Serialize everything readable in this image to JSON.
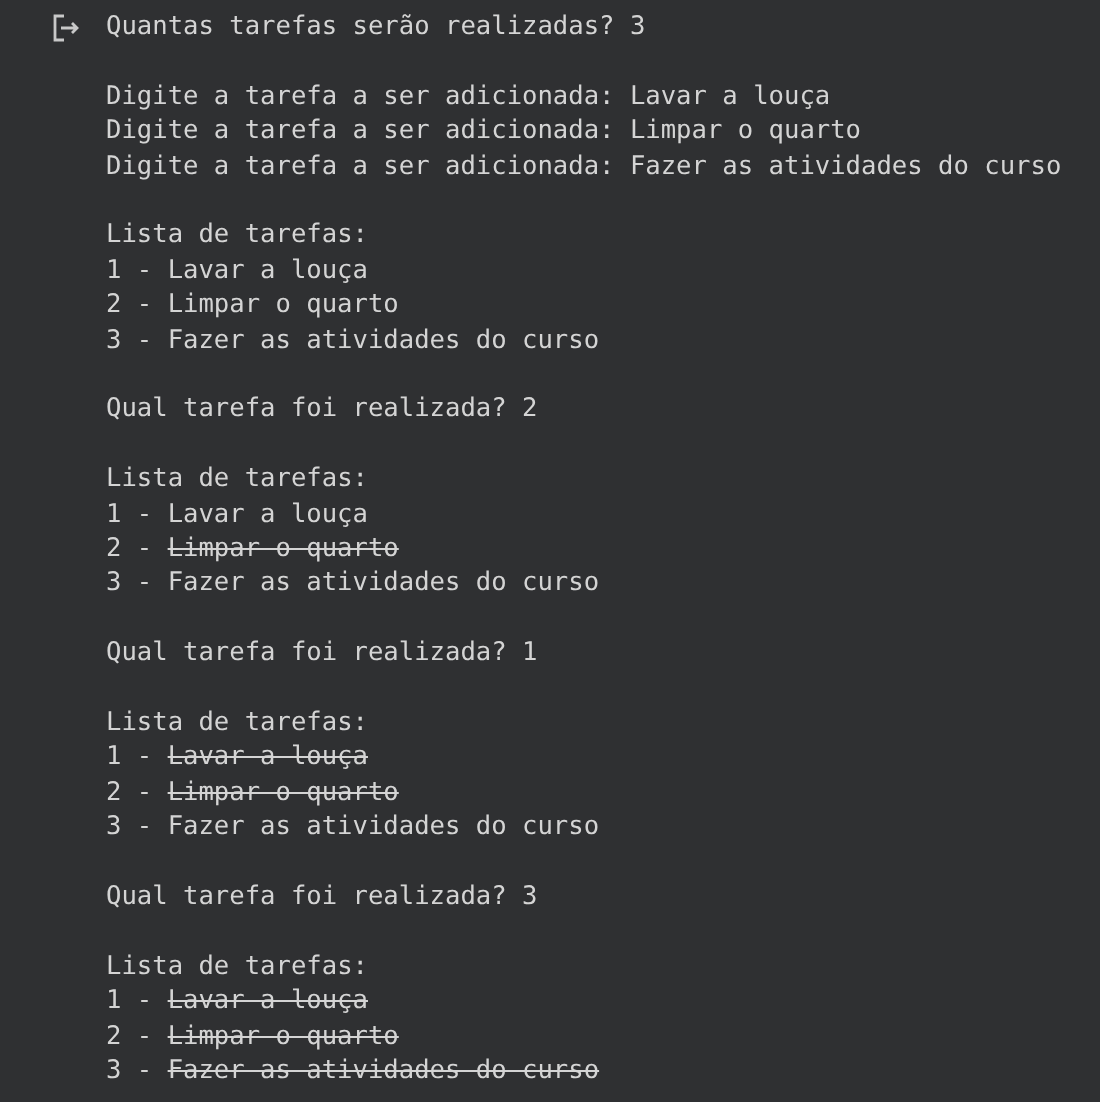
{
  "output_blocks": [
    {
      "lines": [
        {
          "kind": "text",
          "text": "Quantas tarefas serão realizadas? 3"
        }
      ]
    },
    {
      "lines": [
        {
          "kind": "text",
          "text": "Digite a tarefa a ser adicionada: Lavar a louça"
        },
        {
          "kind": "text",
          "text": "Digite a tarefa a ser adicionada: Limpar o quarto"
        },
        {
          "kind": "text",
          "text": "Digite a tarefa a ser adicionada: Fazer as atividades do curso"
        }
      ]
    },
    {
      "lines": [
        {
          "kind": "text",
          "text": "Lista de tarefas:"
        },
        {
          "kind": "task",
          "prefix": "1 -",
          "label": "Lavar a louça",
          "done": false
        },
        {
          "kind": "task",
          "prefix": "2 -",
          "label": "Limpar o quarto",
          "done": false
        },
        {
          "kind": "task",
          "prefix": "3 -",
          "label": "Fazer as atividades do curso",
          "done": false
        }
      ]
    },
    {
      "lines": [
        {
          "kind": "text",
          "text": "Qual tarefa foi realizada? 2"
        }
      ]
    },
    {
      "lines": [
        {
          "kind": "text",
          "text": "Lista de tarefas:"
        },
        {
          "kind": "task",
          "prefix": "1 -",
          "label": "Lavar a louça",
          "done": false
        },
        {
          "kind": "task",
          "prefix": "2 -",
          "label": "Limpar o quarto",
          "done": true
        },
        {
          "kind": "task",
          "prefix": "3 -",
          "label": "Fazer as atividades do curso",
          "done": false
        }
      ]
    },
    {
      "lines": [
        {
          "kind": "text",
          "text": "Qual tarefa foi realizada? 1"
        }
      ]
    },
    {
      "lines": [
        {
          "kind": "text",
          "text": "Lista de tarefas:"
        },
        {
          "kind": "task",
          "prefix": "1 -",
          "label": "Lavar a louça",
          "done": true
        },
        {
          "kind": "task",
          "prefix": "2 -",
          "label": "Limpar o quarto",
          "done": true
        },
        {
          "kind": "task",
          "prefix": "3 -",
          "label": "Fazer as atividades do curso",
          "done": false
        }
      ]
    },
    {
      "lines": [
        {
          "kind": "text",
          "text": "Qual tarefa foi realizada? 3"
        }
      ]
    },
    {
      "lines": [
        {
          "kind": "text",
          "text": "Lista de tarefas:"
        },
        {
          "kind": "task",
          "prefix": "1 -",
          "label": "Lavar a louça",
          "done": true
        },
        {
          "kind": "task",
          "prefix": "2 -",
          "label": "Limpar o quarto",
          "done": true
        },
        {
          "kind": "task",
          "prefix": "3 -",
          "label": "Fazer as atividades do curso",
          "done": true
        }
      ]
    }
  ]
}
